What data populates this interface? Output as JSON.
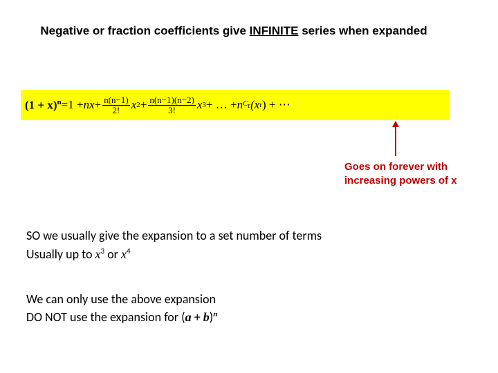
{
  "title_part1": "Negative or fraction coefficients give ",
  "title_infinite": "INFINITE",
  "title_part2": " series when expanded",
  "formula": {
    "lhs_base": "(1 + x)",
    "lhs_exp": "n",
    "eq": " = ",
    "t1": "1 + ",
    "t2a": "n",
    "t2b": "x",
    "t2c": " + ",
    "f1_num": "n(n−1)",
    "f1_den": "2!",
    "t3": " x",
    "t3e": "2",
    "t3c": " + ",
    "f2_num": "n(n−1)(n−2)",
    "f2_den": "3!",
    "t4": " x",
    "t4e": "3",
    "t4c": " + … + ",
    "ncr_n": "n",
    "ncr_C": "C",
    "ncr_r": "r",
    "xr_l": " (x",
    "xr_e": "r",
    "xr_r": ") + ⋯"
  },
  "annotation": "Goes on forever with increasing powers of x",
  "body1_l1a": "SO   we usually give the expansion to a set number of terms",
  "body1_l2a": "Usually up to ",
  "body1_x3": "x",
  "body1_x3e": "3",
  "body1_or": "  or  ",
  "body1_x4": "x",
  "body1_x4e": "4",
  "body2_l1": "We can only use the above expansion",
  "body2_l2a": "DO NOT use the expansion for ",
  "body2_ab_l": "(",
  "body2_a": "a",
  "body2_plus": " + ",
  "body2_b": "b",
  "body2_ab_r": ")",
  "body2_n": "n"
}
